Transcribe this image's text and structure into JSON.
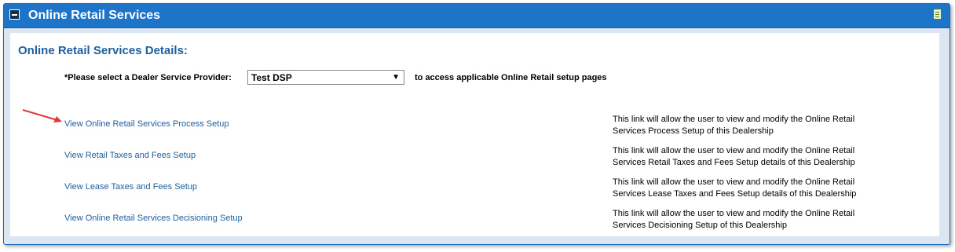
{
  "header": {
    "title": "Online Retail Services",
    "collapse_icon": "minus-square-icon",
    "action_icon": "document-icon"
  },
  "section": {
    "title": "Online Retail Services Details:"
  },
  "dsp": {
    "label": "*Please select a Dealer Service Provider:",
    "selected": "Test DSP",
    "dropdown_icon": "chevron-down-icon",
    "suffix": "to access applicable Online Retail setup pages"
  },
  "rows": [
    {
      "link": "View Online Retail Services Process Setup",
      "description": "This link will allow the user to view and modify the Online Retail Services Process Setup of this Dealership"
    },
    {
      "link": "View Retail Taxes and Fees Setup",
      "description": "This link will allow the user to view and modify the Online Retail Services Retail Taxes and Fees Setup details of this Dealership"
    },
    {
      "link": "View Lease Taxes and Fees Setup",
      "description": "This link will allow the user to view and modify the Online Retail Services Lease Taxes and Fees Setup details of this Dealership"
    },
    {
      "link": "View Online Retail Services Decisioning Setup",
      "description": "This link will allow the user to view and modify the Online Retail Services Decisioning Setup of this Dealership"
    }
  ],
  "annotation": {
    "icon": "red-arrow-icon",
    "color": "#e03a3a"
  },
  "colors": {
    "header_bg": "#1e74c9",
    "link": "#1f5f9e",
    "panel_bg": "#dbe6f2"
  }
}
